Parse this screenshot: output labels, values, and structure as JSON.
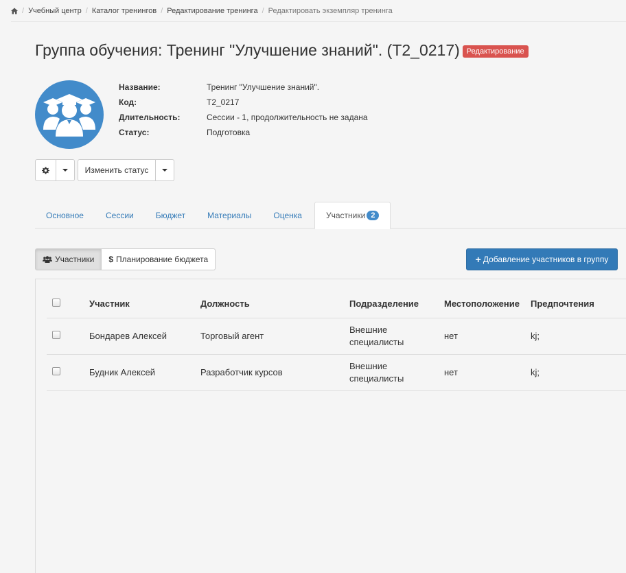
{
  "breadcrumb": {
    "home_icon": "home-icon",
    "items": [
      "Учебный центр",
      "Каталог тренингов",
      "Редактирование тренинга",
      "Редактировать экземпляр тренинга"
    ]
  },
  "title": "Группа обучения: Тренинг \"Улучшение знаний\". (T2_0217)",
  "status_badge": "Редактирование",
  "info": {
    "name_label": "Название:",
    "name_value": "Тренинг \"Улучшение знаний\".",
    "code_label": "Код:",
    "code_value": "T2_0217",
    "duration_label": "Длительность:",
    "duration_value": "Сессии - 1, продолжительность не задана",
    "status_label": "Статус:",
    "status_value": "Подготовка"
  },
  "actions": {
    "change_status": "Изменить статус"
  },
  "tabs": [
    {
      "label": "Основное"
    },
    {
      "label": "Сессии"
    },
    {
      "label": "Бюджет"
    },
    {
      "label": "Материалы"
    },
    {
      "label": "Оценка"
    },
    {
      "label": "Участники",
      "count": "2"
    }
  ],
  "subnav": {
    "participants": "Участники",
    "budget_planning": "Планирование бюджета"
  },
  "add_button": "Добавление участников в группу",
  "table": {
    "headers": [
      "Участник",
      "Должность",
      "Подразделение",
      "Местоположение",
      "Предпочтения"
    ],
    "rows": [
      [
        "Бондарев Алексей",
        "Торговый агент",
        "Внешние специалисты",
        "нет",
        "kj;"
      ],
      [
        "Будник Алексей",
        "Разработчик курсов",
        "Внешние специалисты",
        "нет",
        "kj;"
      ]
    ]
  },
  "colors": {
    "primary": "#337ab7",
    "danger": "#d9534f",
    "avatar_bg": "#428bca"
  }
}
